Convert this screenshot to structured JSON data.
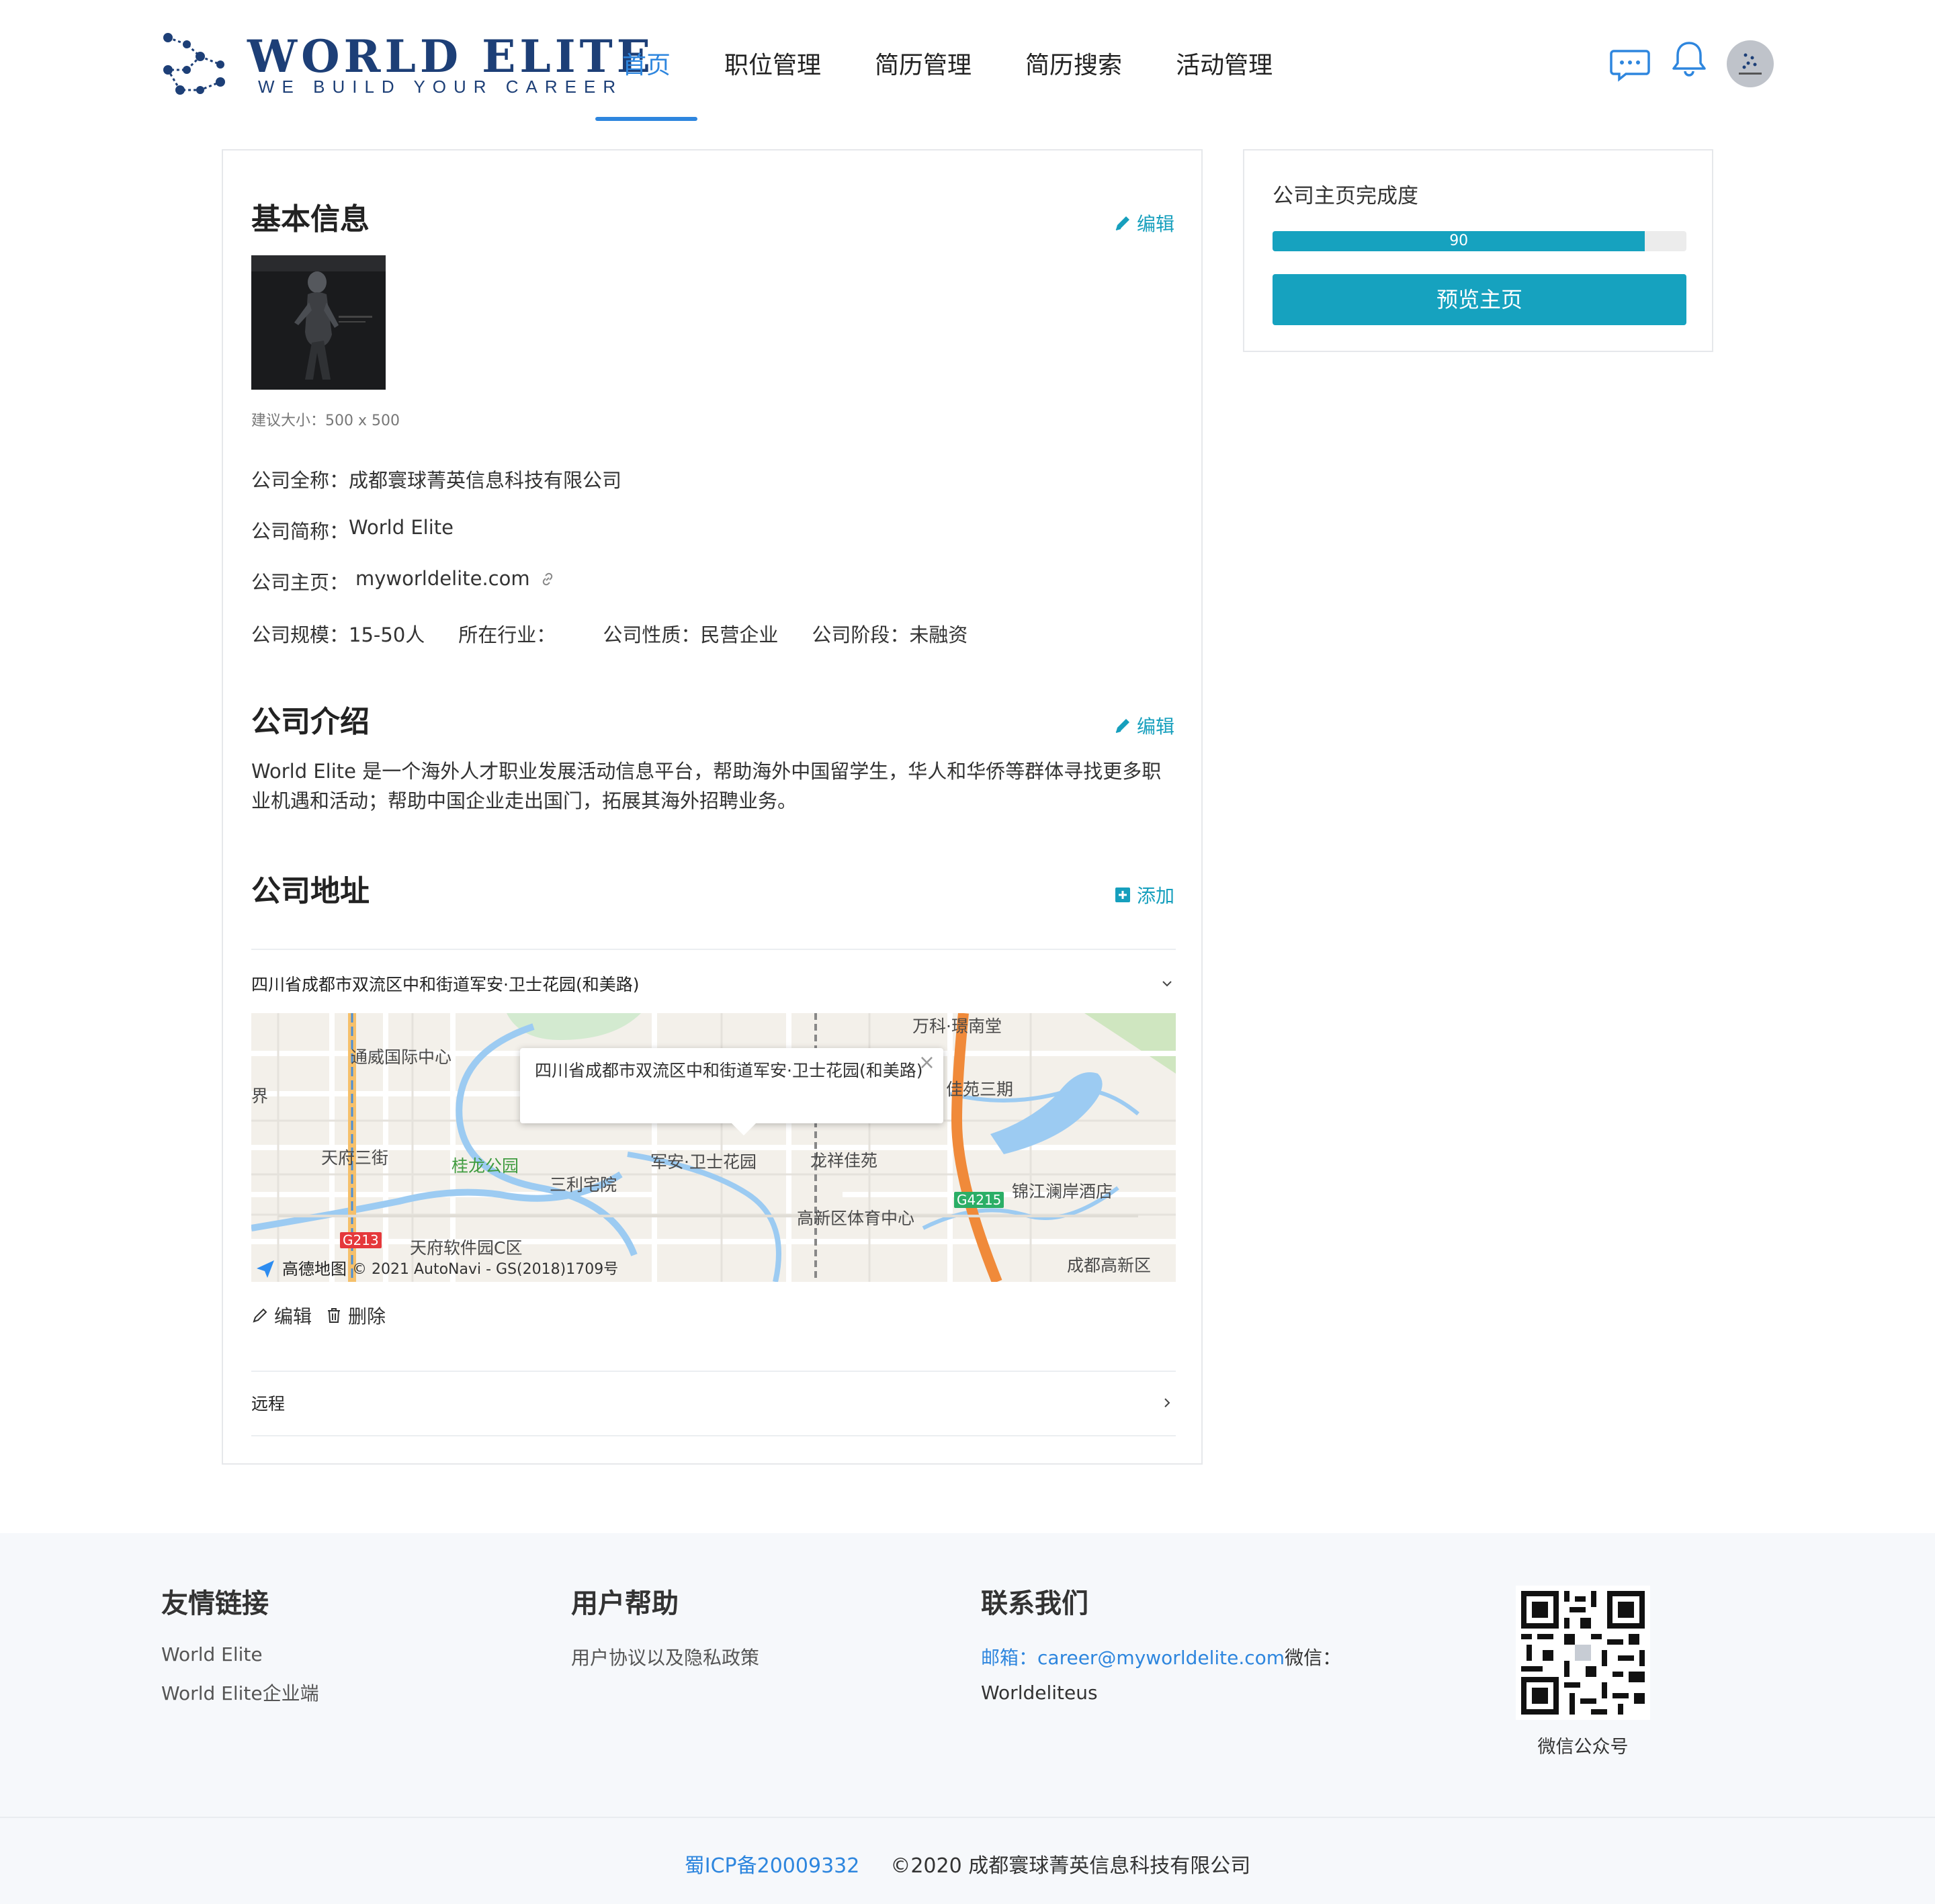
{
  "brand": {
    "title": "WORLD ELITE",
    "subtitle": "WE BUILD YOUR CAREER",
    "color": "#1d3f77"
  },
  "nav": {
    "items": [
      {
        "label": "首页",
        "active": true
      },
      {
        "label": "职位管理"
      },
      {
        "label": "简历管理"
      },
      {
        "label": "简历搜索"
      },
      {
        "label": "活动管理"
      }
    ],
    "icons": [
      "chat-icon",
      "bell-icon",
      "avatar"
    ]
  },
  "basic_info": {
    "title": "基本信息",
    "edit_label": "编辑",
    "logo_hint": "建议大小：500 x 500",
    "full_name_label": "公司全称：",
    "full_name": "成都寰球菁英信息科技有限公司",
    "short_name_label": "公司简称：",
    "short_name": "World Elite",
    "homepage_label": "公司主页：",
    "homepage": "myworldelite.com",
    "scale_label": "公司规模：",
    "scale": "15-50人",
    "industry_label": "所在行业：",
    "industry": "",
    "nature_label": "公司性质：",
    "nature": "民营企业",
    "stage_label": "公司阶段：",
    "stage": "未融资"
  },
  "intro": {
    "title": "公司介绍",
    "edit_label": "编辑",
    "text": "World Elite 是一个海外人才职业发展活动信息平台，帮助海外中国留学生，华人和华侨等群体寻找更多职业机遇和活动；帮助中国企业走出国门，拓展其海外招聘业务。"
  },
  "address": {
    "title": "公司地址",
    "add_label": "添加",
    "items": [
      {
        "label": "四川省成都市双流区中和街道军安·卫士花园(和美路)",
        "expanded": true
      },
      {
        "label": "远程",
        "expanded": false
      }
    ],
    "popup_text": "四川省成都市双流区中和街道军安·卫士花园(和美路)",
    "popup_close": "×",
    "edit_label": "编辑",
    "delete_label": "删除",
    "map": {
      "labels": [
        "万科·璟南堂",
        "通威国际中心",
        "界",
        "佳苑三期",
        "天府三街",
        "桂龙公园",
        "三利宅院",
        "军安·卫士花园",
        "龙祥佳苑",
        "锦江澜岸酒店",
        "高新区体育中心",
        "天府软件园C区",
        "成都高新区"
      ],
      "roads": [
        "G213",
        "G4215"
      ],
      "provider": "高德地图",
      "copyright": "© 2021 AutoNavi - GS(2018)1709号"
    }
  },
  "completion": {
    "title": "公司主页完成度",
    "value": 90,
    "value_label": "90",
    "button_label": "预览主页",
    "accent": "#16a2bf"
  },
  "footer": {
    "links_title": "友情链接",
    "links": [
      "World Elite",
      "World Elite企业端"
    ],
    "help_title": "用户帮助",
    "help_links": [
      "用户协议以及隐私政策"
    ],
    "contact_title": "联系我们",
    "email_label": "邮箱：",
    "email": "career@myworldelite.com",
    "wechat_label": "微信：",
    "wechat": "Worldeliteus",
    "qr_caption": "微信公众号",
    "icp": "蜀ICP备20009332",
    "copyright": "©2020 成都寰球菁英信息科技有限公司"
  }
}
